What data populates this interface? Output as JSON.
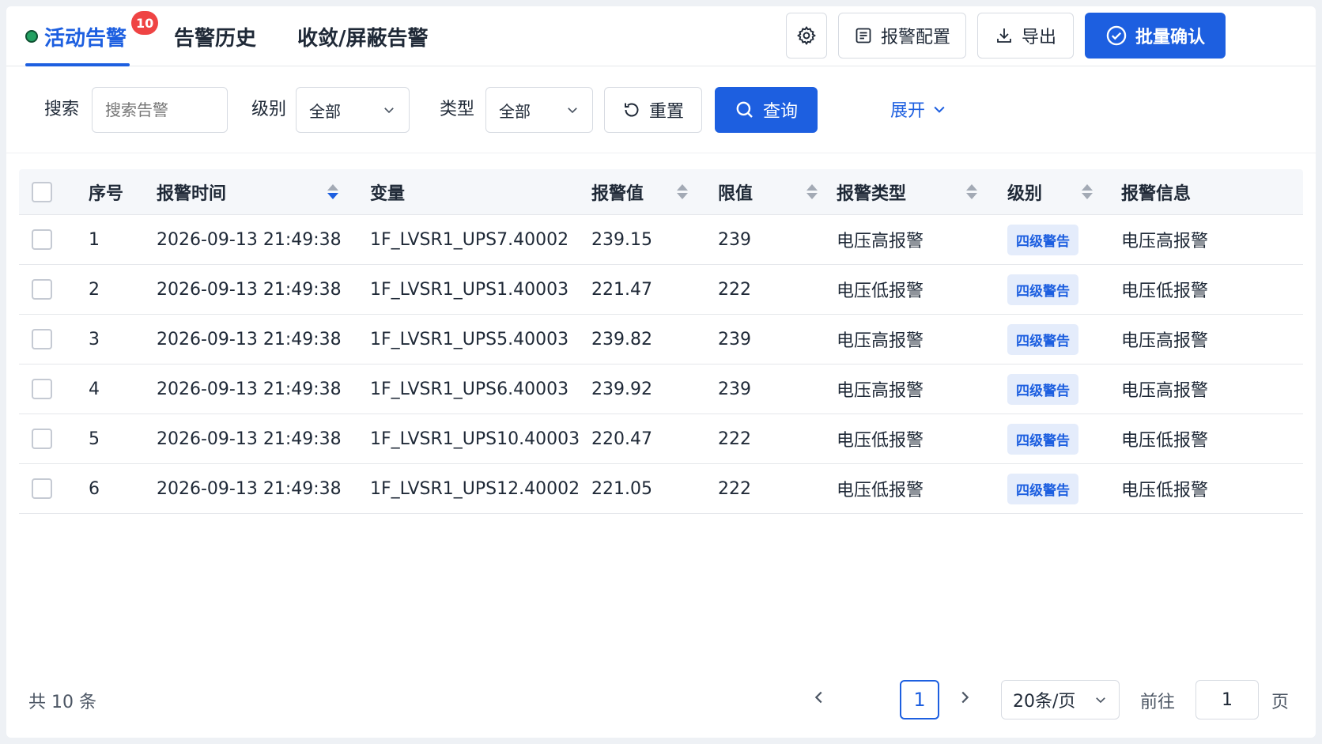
{
  "tabs": [
    {
      "label": "活动告警",
      "badge": "10",
      "active": true
    },
    {
      "label": "告警历史"
    },
    {
      "label": "收敛/屏蔽告警"
    }
  ],
  "toolbar": {
    "alarm_config_label": "报警配置",
    "export_label": "导出",
    "batch_confirm_label": "批量确认"
  },
  "filters": {
    "search_label": "搜索",
    "search_placeholder": "搜索告警",
    "level_label": "级别",
    "level_value": "全部",
    "type_label": "类型",
    "type_value": "全部",
    "reset_label": "重置",
    "query_label": "查询",
    "expand_label": "展开"
  },
  "table": {
    "columns": [
      "序号",
      "报警时间",
      "变量",
      "报警值",
      "限值",
      "报警类型",
      "级别",
      "报警信息"
    ],
    "rows": [
      {
        "no": "1",
        "time": "2026-09-13 21:49:38",
        "var": "1F_LVSR1_UPS7.40002",
        "value": "239.15",
        "limit": "239",
        "type": "电压高报警",
        "level": "四级警告",
        "info": "电压高报警"
      },
      {
        "no": "2",
        "time": "2026-09-13 21:49:38",
        "var": "1F_LVSR1_UPS1.40003",
        "value": "221.47",
        "limit": "222",
        "type": "电压低报警",
        "level": "四级警告",
        "info": "电压低报警"
      },
      {
        "no": "3",
        "time": "2026-09-13 21:49:38",
        "var": "1F_LVSR1_UPS5.40003",
        "value": "239.82",
        "limit": "239",
        "type": "电压高报警",
        "level": "四级警告",
        "info": "电压高报警"
      },
      {
        "no": "4",
        "time": "2026-09-13 21:49:38",
        "var": "1F_LVSR1_UPS6.40003",
        "value": "239.92",
        "limit": "239",
        "type": "电压高报警",
        "level": "四级警告",
        "info": "电压高报警"
      },
      {
        "no": "5",
        "time": "2026-09-13 21:49:38",
        "var": "1F_LVSR1_UPS10.40003",
        "value": "220.47",
        "limit": "222",
        "type": "电压低报警",
        "level": "四级警告",
        "info": "电压低报警"
      },
      {
        "no": "6",
        "time": "2026-09-13 21:49:38",
        "var": "1F_LVSR1_UPS12.40002",
        "value": "221.05",
        "limit": "222",
        "type": "电压低报警",
        "level": "四级警告",
        "info": "电压低报警"
      }
    ]
  },
  "pagination": {
    "total": "共 10 条",
    "current_page": "1",
    "page_size": "20条/页",
    "goto_label": "前往",
    "goto_value": "1",
    "page_suffix": "页"
  },
  "colors": {
    "primary": "#1d5fe0",
    "badge": "#ef4444",
    "status_dot": "#23a162",
    "level_tag_bg": "#e4ecfb"
  }
}
